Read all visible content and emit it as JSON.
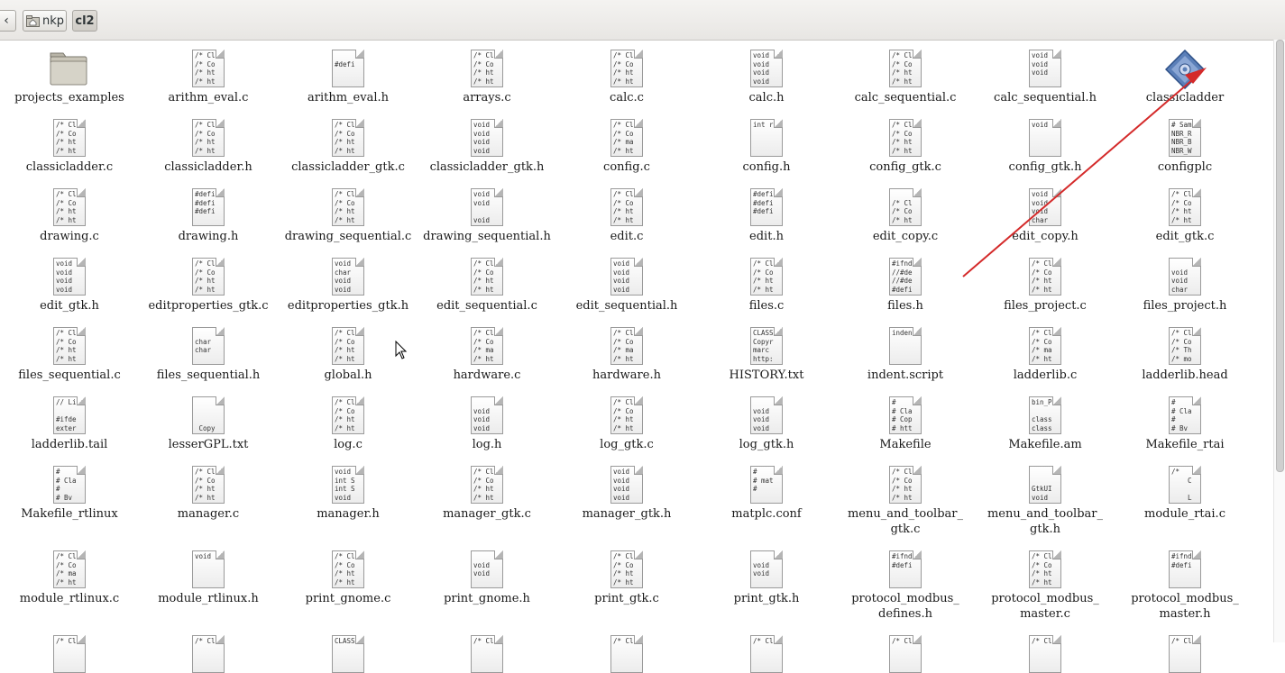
{
  "pathbar": {
    "back_icon": "chevron-left-icon",
    "crumbs": [
      {
        "label": "nkp",
        "icon": "home-folder-icon"
      },
      {
        "label": "cl2"
      }
    ]
  },
  "files": [
    {
      "name": "projects_examples",
      "kind": "folder",
      "preview": ""
    },
    {
      "name": "arithm_eval.c",
      "kind": "text",
      "preview": "/* Cl\n/* Co\n/* ht\n/* ht"
    },
    {
      "name": "arithm_eval.h",
      "kind": "text",
      "preview": "\n#defi"
    },
    {
      "name": "arrays.c",
      "kind": "text",
      "preview": "/* Cl\n/* Co\n/* ht\n/* ht"
    },
    {
      "name": "calc.c",
      "kind": "text",
      "preview": "/* Cl\n/* Co\n/* ht\n/* ht"
    },
    {
      "name": "calc.h",
      "kind": "text",
      "preview": "void\nvoid\nvoid\nvoid"
    },
    {
      "name": "calc_sequential.c",
      "kind": "text",
      "preview": "/* Cl\n/* Co\n/* ht\n/* ht"
    },
    {
      "name": "calc_sequential.h",
      "kind": "text",
      "preview": "void\nvoid\nvoid"
    },
    {
      "name": "classicladder",
      "kind": "executable",
      "preview": ""
    },
    {
      "name": "classicladder.c",
      "kind": "text",
      "preview": "/* Cl\n/* Co\n/* ht\n/* ht"
    },
    {
      "name": "classicladder.h",
      "kind": "text",
      "preview": "/* Cl\n/* Co\n/* ht\n/* ht"
    },
    {
      "name": "classicladder_gtk.c",
      "kind": "text",
      "preview": "/* Cl\n/* Co\n/* ht\n/* ht"
    },
    {
      "name": "classicladder_gtk.h",
      "kind": "text",
      "preview": "void\nvoid\nvoid\nvoid"
    },
    {
      "name": "config.c",
      "kind": "text",
      "preview": "/* Cl\n/* Co\n/* ma\n/* ht"
    },
    {
      "name": "config.h",
      "kind": "text",
      "preview": "int r"
    },
    {
      "name": "config_gtk.c",
      "kind": "text",
      "preview": "/* Cl\n/* Co\n/* ht\n/* ht"
    },
    {
      "name": "config_gtk.h",
      "kind": "text",
      "preview": "void"
    },
    {
      "name": "configplc",
      "kind": "text",
      "preview": "# Sam\nNBR_R\nNBR_B\nNBR_W"
    },
    {
      "name": "drawing.c",
      "kind": "text",
      "preview": "/* Cl\n/* Co\n/* ht\n/* ht"
    },
    {
      "name": "drawing.h",
      "kind": "text",
      "preview": "#defi\n#defi\n#defi"
    },
    {
      "name": "drawing_sequential.c",
      "kind": "text",
      "preview": "/* Cl\n/* Co\n/* ht\n/* ht"
    },
    {
      "name": "drawing_sequential.h",
      "kind": "text",
      "preview": "void\nvoid\n\nvoid"
    },
    {
      "name": "edit.c",
      "kind": "text",
      "preview": "/* Cl\n/* Co\n/* ht\n/* ht"
    },
    {
      "name": "edit.h",
      "kind": "text",
      "preview": "#defi\n#defi\n#defi"
    },
    {
      "name": "edit_copy.c",
      "kind": "text",
      "preview": "\n/* Cl\n/* Co\n/* ht"
    },
    {
      "name": "edit_copy.h",
      "kind": "text",
      "preview": "void\nvoid\nvoid\nchar"
    },
    {
      "name": "edit_gtk.c",
      "kind": "text",
      "preview": "/* Cl\n/* Co\n/* ht\n/* ht"
    },
    {
      "name": "edit_gtk.h",
      "kind": "text",
      "preview": "void\nvoid\nvoid\nvoid"
    },
    {
      "name": "editproperties_gtk.c",
      "kind": "text",
      "preview": "/* Cl\n/* Co\n/* ht\n/* ht"
    },
    {
      "name": "editproperties_gtk.h",
      "kind": "text",
      "preview": "void\nchar\nvoid\nvoid"
    },
    {
      "name": "edit_sequential.c",
      "kind": "text",
      "preview": "/* Cl\n/* Co\n/* ht\n/* ht"
    },
    {
      "name": "edit_sequential.h",
      "kind": "text",
      "preview": "void\nvoid\nvoid\nvoid"
    },
    {
      "name": "files.c",
      "kind": "text",
      "preview": "/* Cl\n/* Co\n/* ht\n/* ht"
    },
    {
      "name": "files.h",
      "kind": "text",
      "preview": "#ifnd\n//#de\n//#de\n#defi"
    },
    {
      "name": "files_project.c",
      "kind": "text",
      "preview": "/* Cl\n/* Co\n/* ht\n/* ht"
    },
    {
      "name": "files_project.h",
      "kind": "text",
      "preview": "\nvoid\nvoid\nchar"
    },
    {
      "name": "files_sequential.c",
      "kind": "text",
      "preview": "/* Cl\n/* Co\n/* ht\n/* ht"
    },
    {
      "name": "files_sequential.h",
      "kind": "text",
      "preview": "\nchar\nchar"
    },
    {
      "name": "global.h",
      "kind": "text",
      "preview": "/* Cl\n/* Co\n/* ht\n/* ht"
    },
    {
      "name": "hardware.c",
      "kind": "text",
      "preview": "/* Cl\n/* Co\n/* ma\n/* ht"
    },
    {
      "name": "hardware.h",
      "kind": "text",
      "preview": "/* Cl\n/* Co\n/* ma\n/* ht"
    },
    {
      "name": "HISTORY.txt",
      "kind": "text",
      "preview": "CLASS\nCopyr\nmarc\nhttp:"
    },
    {
      "name": "indent.script",
      "kind": "text",
      "preview": "inden"
    },
    {
      "name": "ladderlib.c",
      "kind": "text",
      "preview": "/* Cl\n/* Co\n/* ma\n/* ht"
    },
    {
      "name": "ladderlib.head",
      "kind": "text",
      "preview": "/* Cl\n/* Co\n/* Th\n/* mo"
    },
    {
      "name": "ladderlib.tail",
      "kind": "text",
      "preview": "// Li\n\n#ifde\nexter"
    },
    {
      "name": "lesserGPL.txt",
      "kind": "text",
      "preview": "     GN\n\n\n Copy"
    },
    {
      "name": "log.c",
      "kind": "text",
      "preview": "/* Cl\n/* Co\n/* ht\n/* ht"
    },
    {
      "name": "log.h",
      "kind": "text",
      "preview": "\nvoid\nvoid\nvoid"
    },
    {
      "name": "log_gtk.c",
      "kind": "text",
      "preview": "/* Cl\n/* Co\n/* ht\n/* ht"
    },
    {
      "name": "log_gtk.h",
      "kind": "text",
      "preview": "\nvoid\nvoid\nvoid"
    },
    {
      "name": "Makefile",
      "kind": "text",
      "preview": "#\n# Cla\n# Cop\n# htt"
    },
    {
      "name": "Makefile.am",
      "kind": "text",
      "preview": "bin_P\n\nclass\nclass"
    },
    {
      "name": "Makefile_rtai",
      "kind": "text",
      "preview": "#\n# Cla\n#\n# Bv"
    },
    {
      "name": "Makefile_rtlinux",
      "kind": "text",
      "preview": "#\n# Cla\n#\n# Bv"
    },
    {
      "name": "manager.c",
      "kind": "text",
      "preview": "/* Cl\n/* Co\n/* ht\n/* ht"
    },
    {
      "name": "manager.h",
      "kind": "text",
      "preview": "void\nint S\nint S\nvoid"
    },
    {
      "name": "manager_gtk.c",
      "kind": "text",
      "preview": "/* Cl\n/* Co\n/* ht\n/* ht"
    },
    {
      "name": "manager_gtk.h",
      "kind": "text",
      "preview": "void\nvoid\nvoid\nvoid"
    },
    {
      "name": "matplc.conf",
      "kind": "text",
      "preview": "#\n# mat\n#"
    },
    {
      "name": "menu_and_toolbar_\ngtk.c",
      "kind": "text",
      "preview": "/* Cl\n/* Co\n/* ht\n/* ht"
    },
    {
      "name": "menu_and_toolbar_\ngtk.h",
      "kind": "text",
      "preview": "\n\nGtkUI\nvoid"
    },
    {
      "name": "module_rtai.c",
      "kind": "text",
      "preview": "/*\n    C\n\n    L"
    },
    {
      "name": "module_rtlinux.c",
      "kind": "text",
      "preview": "/* Cl\n/* Co\n/* ma\n/* ht"
    },
    {
      "name": "module_rtlinux.h",
      "kind": "text",
      "preview": "void"
    },
    {
      "name": "print_gnome.c",
      "kind": "text",
      "preview": "/* Cl\n/* Co\n/* ht\n/* ht"
    },
    {
      "name": "print_gnome.h",
      "kind": "text",
      "preview": "\nvoid\nvoid"
    },
    {
      "name": "print_gtk.c",
      "kind": "text",
      "preview": "/* Cl\n/* Co\n/* ht\n/* ht"
    },
    {
      "name": "print_gtk.h",
      "kind": "text",
      "preview": "\nvoid\nvoid"
    },
    {
      "name": "protocol_modbus_\ndefines.h",
      "kind": "text",
      "preview": "#ifnd\n#defi"
    },
    {
      "name": "protocol_modbus_\nmaster.c",
      "kind": "text",
      "preview": "/* Cl\n/* Co\n/* ht\n/* ht"
    },
    {
      "name": "protocol_modbus_\nmaster.h",
      "kind": "text",
      "preview": "#ifnd\n#defi"
    },
    {
      "name": "",
      "kind": "text",
      "preview": "/* Cl"
    },
    {
      "name": "",
      "kind": "text",
      "preview": "/* Cl"
    },
    {
      "name": "",
      "kind": "text",
      "preview": "CLASS"
    },
    {
      "name": "",
      "kind": "text",
      "preview": "/* Cl"
    },
    {
      "name": "",
      "kind": "text",
      "preview": "/* Cl"
    },
    {
      "name": "",
      "kind": "text",
      "preview": "/* Cl"
    },
    {
      "name": "",
      "kind": "text",
      "preview": "/* Cl"
    },
    {
      "name": "",
      "kind": "text",
      "preview": "/* Cl"
    },
    {
      "name": "",
      "kind": "text",
      "preview": "/* Cl"
    }
  ],
  "annotation": {
    "color": "#d42a2a",
    "target": "classicladder"
  }
}
